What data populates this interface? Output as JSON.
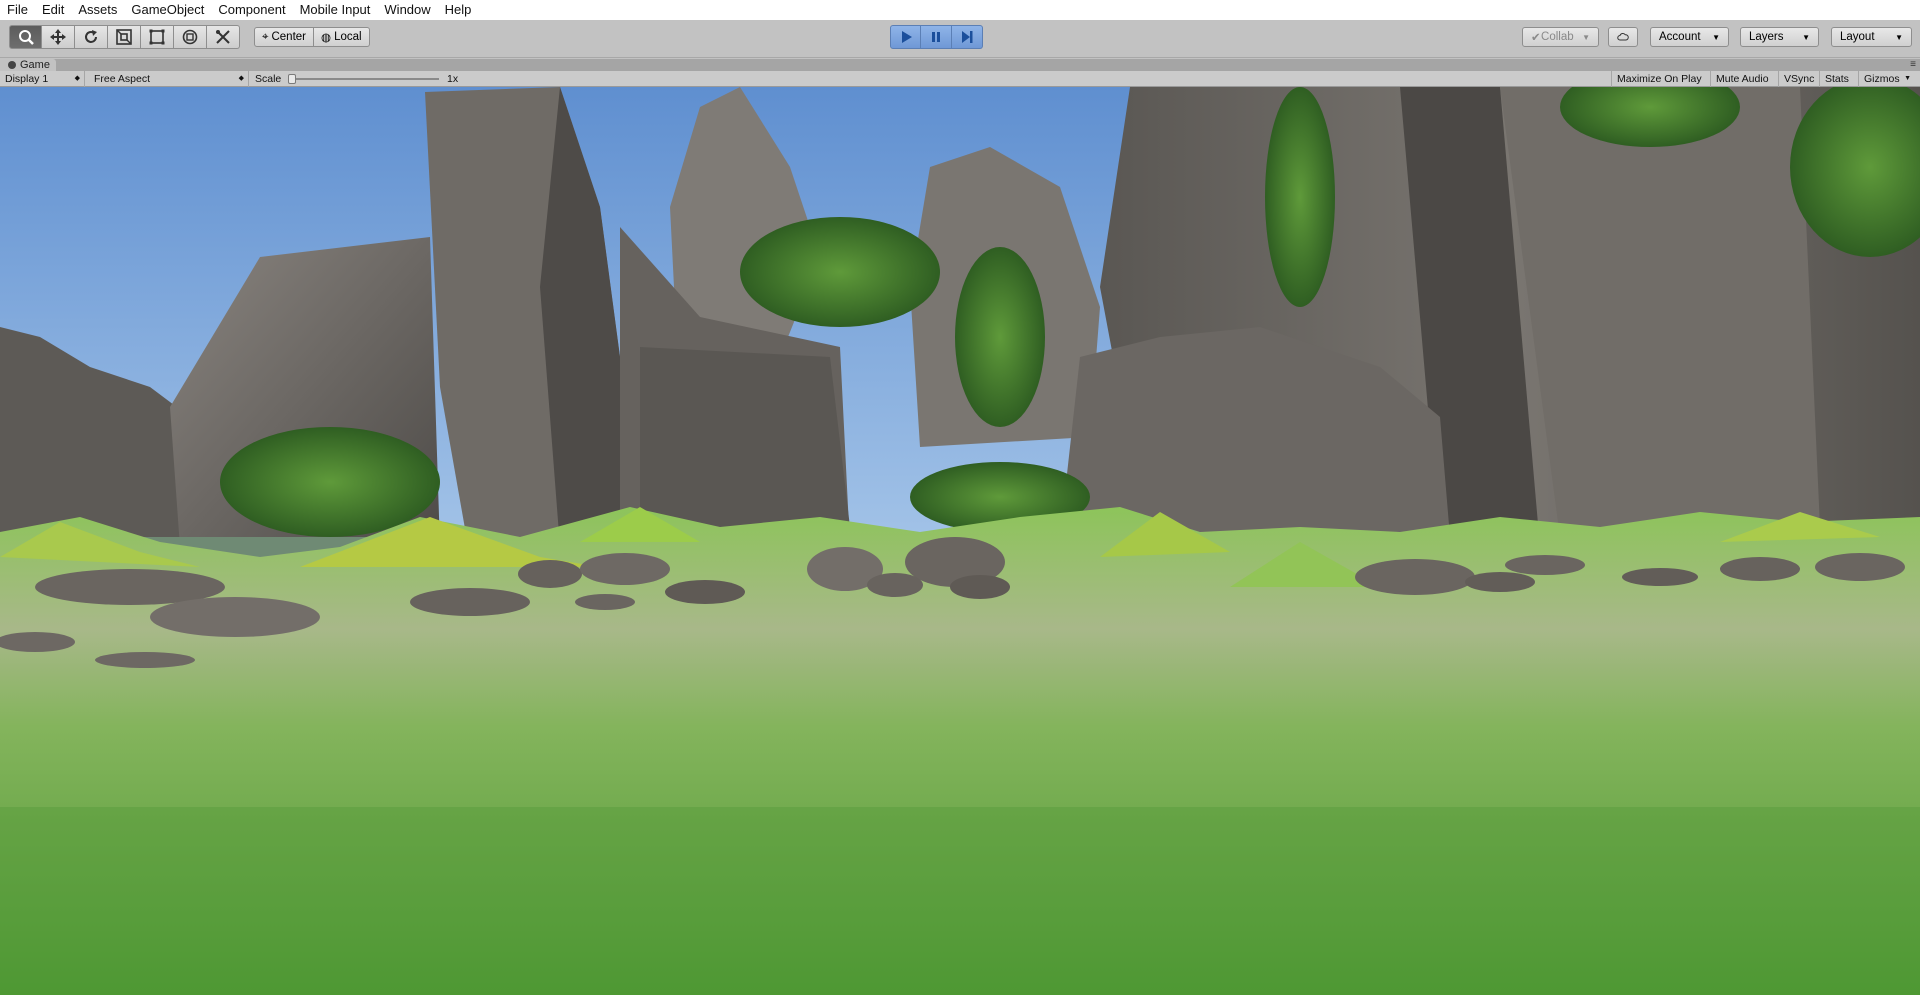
{
  "menu": {
    "items": [
      "File",
      "Edit",
      "Assets",
      "GameObject",
      "Component",
      "Mobile Input",
      "Window",
      "Help"
    ]
  },
  "toolbar": {
    "tools": [
      "hand-tool-icon",
      "move-tool-icon",
      "rotate-tool-icon",
      "scale-tool-icon",
      "rect-tool-icon",
      "transform-tool-icon",
      "custom-tool-icon"
    ],
    "pivot_label": "Center",
    "space_label": "Local",
    "collab_label": "Collab",
    "account_label": "Account",
    "layers_label": "Layers",
    "layout_label": "Layout",
    "play_state": "playing"
  },
  "game_tab": {
    "title": "Game"
  },
  "game_toolbar": {
    "display": "Display 1",
    "aspect": "Free Aspect",
    "scale_label": "Scale",
    "scale_value": "1x",
    "maximize_on_play": "Maximize On Play",
    "mute_audio": "Mute Audio",
    "vsync": "VSync",
    "stats": "Stats",
    "gizmos": "Gizmos"
  },
  "colors": {
    "sky": "#6f9fd8",
    "grass": "#6fb33e",
    "rock": "#6d6a66",
    "play_accent": "#6f98d6"
  }
}
